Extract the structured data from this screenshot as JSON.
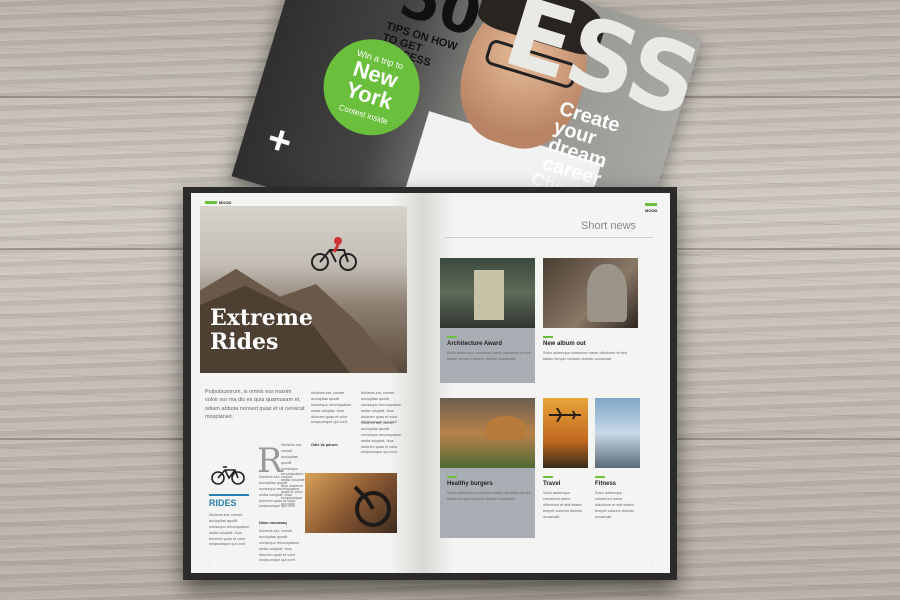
{
  "magazine": {
    "masthead": "ESS",
    "number": "50",
    "tips": "TIPS ON HOW TO GET SUCCESS",
    "badge": {
      "win": "Win a trip to",
      "city": "New York",
      "sub": "Contest inside"
    },
    "plus": "+",
    "side_headline": "Create your dream career",
    "side_headline2": "Check in"
  },
  "left_page": {
    "tag": "MOOD",
    "hero_title_line1": "Extreme",
    "hero_title_line2": "Rides",
    "intro": "Pulputsumrum, is omnis ess maxim voloir sur ma dis es quia quamusam et, odiam abbota nonsed quiat et ut nereicat mosplaniet.",
    "dropcap": "R",
    "section_label": "RIDES",
    "subhead_1": "Odis de parum",
    "subhead_2": "Nimo nonsaraq",
    "col_filler": "Ihicienis est, conset acclupitas quodit nonsequo rerumquatum sedia voluptat. Ibus dolorem quas et volor sinipsumque qui corit."
  },
  "right_page": {
    "tag": "MOOD",
    "heading": "Short news",
    "items": [
      {
        "title": "Architecture Award"
      },
      {
        "title": "New album out"
      },
      {
        "title": "Healthy burgers"
      },
      {
        "title": "Travel"
      },
      {
        "title": "Fitness"
      }
    ],
    "filler": "Solor autemquo conserunt orerie ollectione et ebit tatiam tempel volorem dolesto occaecati."
  },
  "colors": {
    "accent_green": "#6abf3c",
    "accent_blue": "#2a7fb0",
    "book_cover": "#2b2b2b"
  }
}
